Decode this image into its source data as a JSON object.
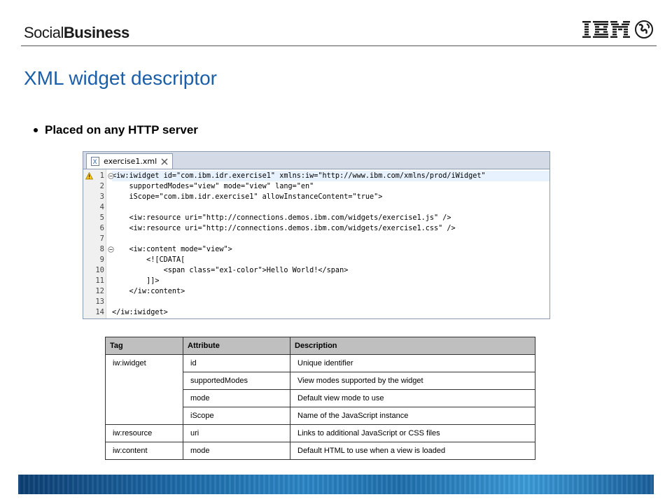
{
  "header": {
    "brand_light": "Social",
    "brand_bold": "Business"
  },
  "slide": {
    "title": "XML widget descriptor",
    "bullet": "Placed on any HTTP server"
  },
  "editor": {
    "tab_label": "exercise1.xml",
    "line_numbers": [
      "1",
      "2",
      "3",
      "4",
      "5",
      "6",
      "7",
      "8",
      "9",
      "10",
      "11",
      "12",
      "13",
      "14"
    ],
    "lines": [
      "<iw:iwidget id=\"com.ibm.idr.exercise1\" xmlns:iw=\"http://www.ibm.com/xmlns/prod/iWidget\"",
      "    supportedModes=\"view\" mode=\"view\" lang=\"en\"",
      "    iScope=\"com.ibm.idr.exercise1\" allowInstanceContent=\"true\">",
      "",
      "    <iw:resource uri=\"http://connections.demos.ibm.com/widgets/exercise1.js\" />",
      "    <iw:resource uri=\"http://connections.demos.ibm.com/widgets/exercise1.css\" />",
      "",
      "    <iw:content mode=\"view\">",
      "        <![CDATA[",
      "            <span class=\"ex1-color\">Hello World!</span>",
      "        ]]>",
      "    </iw:content>",
      "",
      "</iw:iwidget>"
    ]
  },
  "table": {
    "headers": [
      "Tag",
      "Attribute",
      "Description"
    ],
    "rows": [
      {
        "tag": "iw:iwidget",
        "attribute": "id",
        "description": "Unique identifier"
      },
      {
        "tag": "",
        "attribute": "supportedModes",
        "description": "View modes supported by the widget"
      },
      {
        "tag": "",
        "attribute": "mode",
        "description": "Default view mode to use"
      },
      {
        "tag": "",
        "attribute": "iScope",
        "description": "Name of the JavaScript instance"
      },
      {
        "tag": "iw:resource",
        "attribute": "uri",
        "description": "Links to additional JavaScript or CSS files"
      },
      {
        "tag": "iw:content",
        "attribute": "mode",
        "description": "Default HTML to use when a view is loaded"
      }
    ]
  },
  "colors": {
    "title_blue": "#1b5ea9",
    "table_header_gray": "#bfbfbf",
    "editor_tab_bar": "#d4dbe6"
  }
}
